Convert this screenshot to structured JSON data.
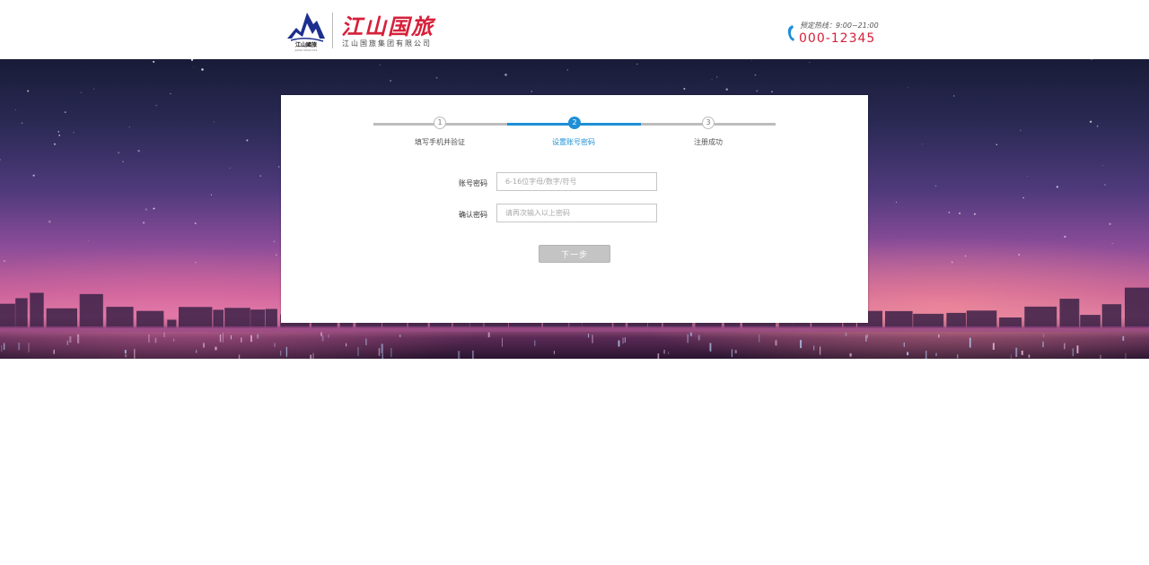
{
  "brand": {
    "name": "江山国旅",
    "company": "江山国旅集团有限公司",
    "emblem_caption": "江山國旅",
    "emblem_sub": "JIANG SHAN GTS"
  },
  "hotline": {
    "label": "预定热线：9:00~21:00",
    "number": "000-12345"
  },
  "steps": [
    {
      "num": "1",
      "label": "填写手机并验证",
      "state": "todo"
    },
    {
      "num": "2",
      "label": "设置账号密码",
      "state": "active"
    },
    {
      "num": "3",
      "label": "注册成功",
      "state": "todo"
    }
  ],
  "form": {
    "password": {
      "label": "账号密码",
      "value": "",
      "placeholder": "6-16位字母/数字/符号"
    },
    "confirm": {
      "label": "确认密码",
      "value": "",
      "placeholder": "请再次输入以上密码"
    }
  },
  "next_label": "下一步",
  "colors": {
    "accent": "#1e8fd6",
    "brand": "#d6203a",
    "step_inactive": "#bdbdbd",
    "button_disabled": "#c4c4c4"
  },
  "icons": [
    "mountain-logo-icon",
    "phone-icon"
  ]
}
